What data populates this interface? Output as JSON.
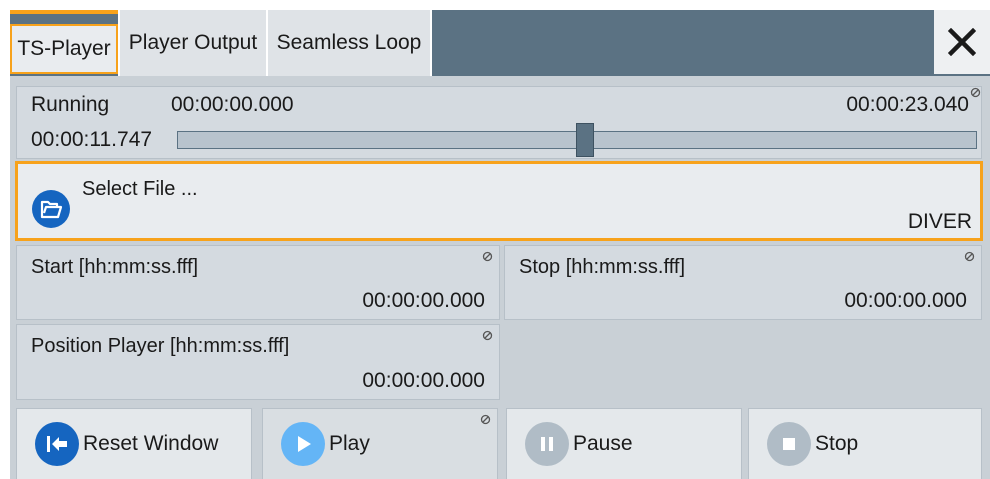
{
  "tabs": [
    {
      "label": "TS-Player",
      "active": true
    },
    {
      "label": "Player Output",
      "active": false
    },
    {
      "label": "Seamless Loop",
      "active": false
    }
  ],
  "status": {
    "state": "Running",
    "start_time": "00:00:00.000",
    "end_time": "00:00:23.040",
    "current_time": "00:00:11.747",
    "progress_fraction": 0.51
  },
  "select_file": {
    "label": "Select File ...",
    "filename": "DIVER"
  },
  "fields": {
    "start": {
      "label": "Start [hh:mm:ss.fff]",
      "value": "00:00:00.000"
    },
    "stop": {
      "label": "Stop [hh:mm:ss.fff]",
      "value": "00:00:00.000"
    },
    "position": {
      "label": "Position Player [hh:mm:ss.fff]",
      "value": "00:00:00.000"
    }
  },
  "buttons": {
    "reset": "Reset Window",
    "play": "Play",
    "pause": "Pause",
    "stop": "Stop"
  },
  "colors": {
    "accent": "#f7a21b",
    "primary": "#1565c0",
    "header": "#5b7283",
    "panel": "#d4dae0",
    "play_icon": "#64b5f6",
    "disabled_icon": "#b0bcc6"
  },
  "icons": {
    "close": "close-icon",
    "file": "folder-open-icon",
    "reset": "skip-back-icon",
    "play": "play-icon",
    "pause": "pause-icon",
    "stop": "stop-icon",
    "link": "no-link-icon"
  }
}
